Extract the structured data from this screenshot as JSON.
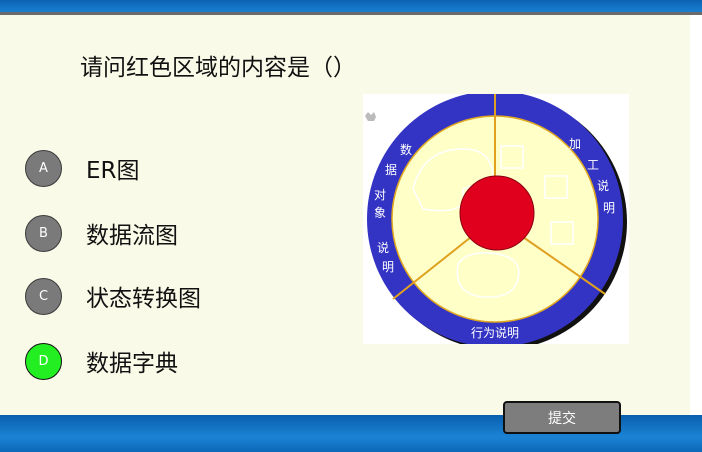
{
  "question": "请问红色区域的内容是（）",
  "options": [
    {
      "key": "A",
      "label": "ER图"
    },
    {
      "key": "B",
      "label": "数据流图"
    },
    {
      "key": "C",
      "label": "状态转换图"
    },
    {
      "key": "D",
      "label": "数据字典"
    }
  ],
  "selected_option": "D",
  "diagram": {
    "left_label_top": "数据对象",
    "left_label_bottom": "说明",
    "right_label": "加工说明",
    "bottom_label": "行为说明"
  },
  "submit_label": "提交",
  "colors": {
    "accent_bar": "#0b62b3",
    "selected": "#22ee22",
    "center_region": "#e0001e",
    "ring": "#3434c4"
  }
}
